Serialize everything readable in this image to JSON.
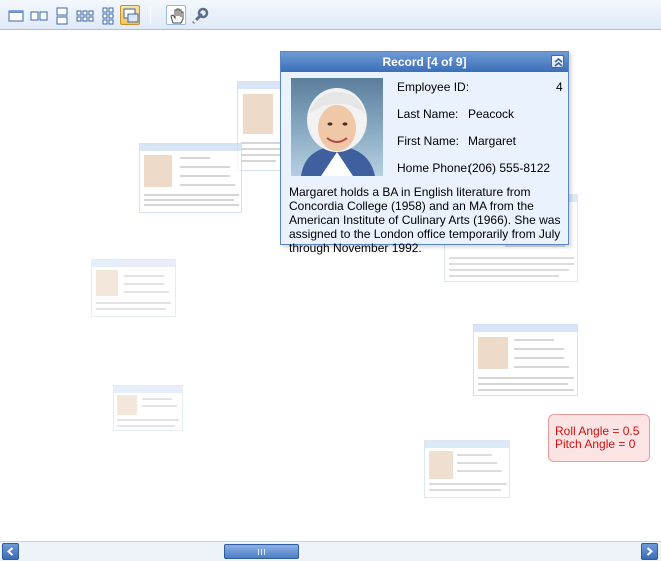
{
  "toolbar": {
    "buttons": [
      {
        "icon": "single-view-icon"
      },
      {
        "icon": "two-column-view-icon"
      },
      {
        "icon": "two-row-view-icon"
      },
      {
        "icon": "grid-view-icon"
      },
      {
        "icon": "tile-view-icon"
      },
      {
        "icon": "carousel-view-icon",
        "active": true
      },
      {
        "icon": "pan-hand-icon"
      },
      {
        "icon": "settings-wrench-icon"
      }
    ]
  },
  "record": {
    "title": "Record [4 of 9]",
    "employee_id_label": "Employee ID:",
    "employee_id": "4",
    "last_name_label": "Last Name:",
    "last_name": "Peacock",
    "first_name_label": "First Name:",
    "first_name": "Margaret",
    "home_phone_label": "Home Phone:",
    "home_phone": "(206) 555-8122",
    "description": "Margaret holds a BA in English literature from Concordia College (1958) and an MA from the American Institute of Culinary Arts (1966).  She was assigned to the London office temporarily from July through November 1992."
  },
  "angles": {
    "roll": "Roll Angle = 0.5",
    "pitch": "Pitch Angle = 0"
  },
  "colors": {
    "accent": "#3c6fb8",
    "popup_bg": "#eaf2fd",
    "angle_text": "#d11010"
  }
}
